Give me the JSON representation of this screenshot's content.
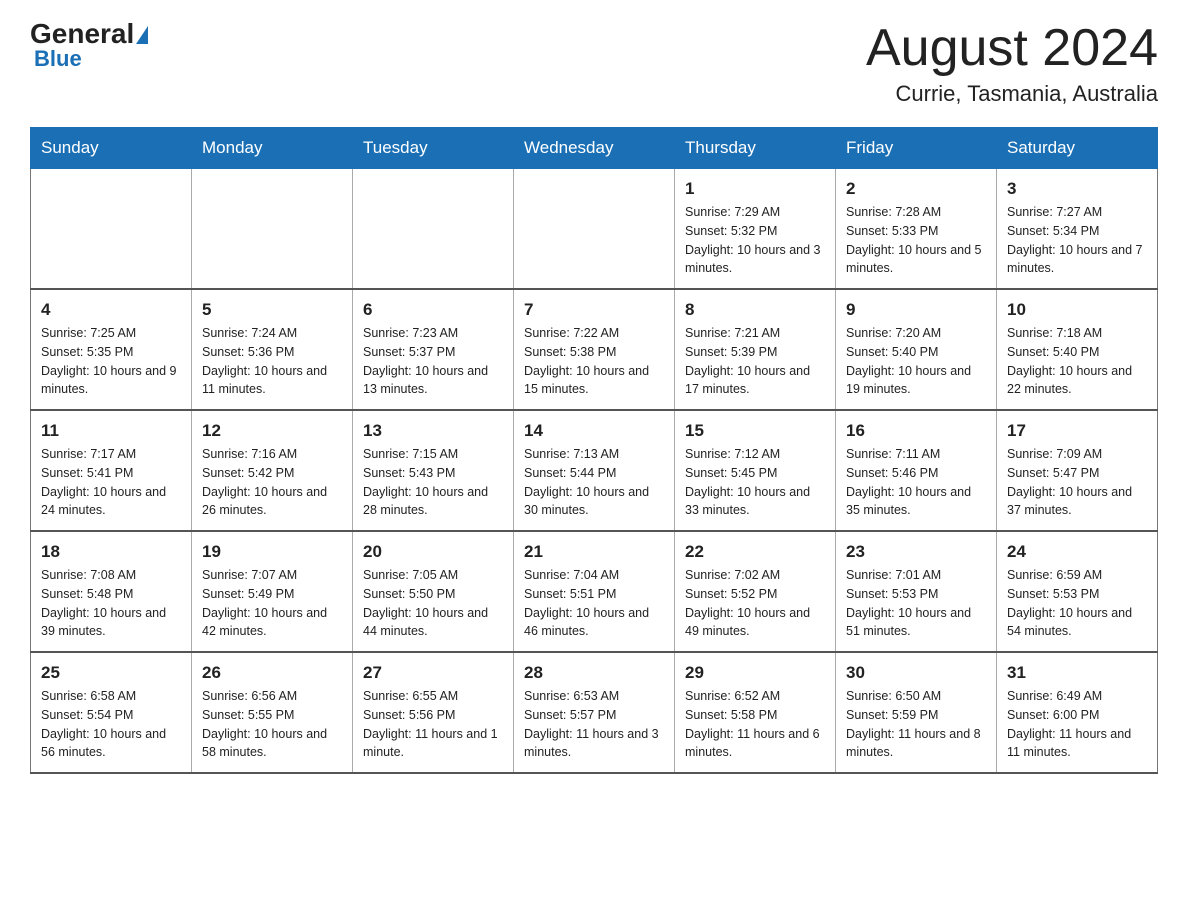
{
  "header": {
    "logo_general": "General",
    "logo_blue": "Blue",
    "title": "August 2024",
    "subtitle": "Currie, Tasmania, Australia"
  },
  "days_of_week": [
    "Sunday",
    "Monday",
    "Tuesday",
    "Wednesday",
    "Thursday",
    "Friday",
    "Saturday"
  ],
  "weeks": [
    [
      {
        "date": "",
        "sunrise": "",
        "sunset": "",
        "daylight": ""
      },
      {
        "date": "",
        "sunrise": "",
        "sunset": "",
        "daylight": ""
      },
      {
        "date": "",
        "sunrise": "",
        "sunset": "",
        "daylight": ""
      },
      {
        "date": "",
        "sunrise": "",
        "sunset": "",
        "daylight": ""
      },
      {
        "date": "1",
        "sunrise": "Sunrise: 7:29 AM",
        "sunset": "Sunset: 5:32 PM",
        "daylight": "Daylight: 10 hours and 3 minutes."
      },
      {
        "date": "2",
        "sunrise": "Sunrise: 7:28 AM",
        "sunset": "Sunset: 5:33 PM",
        "daylight": "Daylight: 10 hours and 5 minutes."
      },
      {
        "date": "3",
        "sunrise": "Sunrise: 7:27 AM",
        "sunset": "Sunset: 5:34 PM",
        "daylight": "Daylight: 10 hours and 7 minutes."
      }
    ],
    [
      {
        "date": "4",
        "sunrise": "Sunrise: 7:25 AM",
        "sunset": "Sunset: 5:35 PM",
        "daylight": "Daylight: 10 hours and 9 minutes."
      },
      {
        "date": "5",
        "sunrise": "Sunrise: 7:24 AM",
        "sunset": "Sunset: 5:36 PM",
        "daylight": "Daylight: 10 hours and 11 minutes."
      },
      {
        "date": "6",
        "sunrise": "Sunrise: 7:23 AM",
        "sunset": "Sunset: 5:37 PM",
        "daylight": "Daylight: 10 hours and 13 minutes."
      },
      {
        "date": "7",
        "sunrise": "Sunrise: 7:22 AM",
        "sunset": "Sunset: 5:38 PM",
        "daylight": "Daylight: 10 hours and 15 minutes."
      },
      {
        "date": "8",
        "sunrise": "Sunrise: 7:21 AM",
        "sunset": "Sunset: 5:39 PM",
        "daylight": "Daylight: 10 hours and 17 minutes."
      },
      {
        "date": "9",
        "sunrise": "Sunrise: 7:20 AM",
        "sunset": "Sunset: 5:40 PM",
        "daylight": "Daylight: 10 hours and 19 minutes."
      },
      {
        "date": "10",
        "sunrise": "Sunrise: 7:18 AM",
        "sunset": "Sunset: 5:40 PM",
        "daylight": "Daylight: 10 hours and 22 minutes."
      }
    ],
    [
      {
        "date": "11",
        "sunrise": "Sunrise: 7:17 AM",
        "sunset": "Sunset: 5:41 PM",
        "daylight": "Daylight: 10 hours and 24 minutes."
      },
      {
        "date": "12",
        "sunrise": "Sunrise: 7:16 AM",
        "sunset": "Sunset: 5:42 PM",
        "daylight": "Daylight: 10 hours and 26 minutes."
      },
      {
        "date": "13",
        "sunrise": "Sunrise: 7:15 AM",
        "sunset": "Sunset: 5:43 PM",
        "daylight": "Daylight: 10 hours and 28 minutes."
      },
      {
        "date": "14",
        "sunrise": "Sunrise: 7:13 AM",
        "sunset": "Sunset: 5:44 PM",
        "daylight": "Daylight: 10 hours and 30 minutes."
      },
      {
        "date": "15",
        "sunrise": "Sunrise: 7:12 AM",
        "sunset": "Sunset: 5:45 PM",
        "daylight": "Daylight: 10 hours and 33 minutes."
      },
      {
        "date": "16",
        "sunrise": "Sunrise: 7:11 AM",
        "sunset": "Sunset: 5:46 PM",
        "daylight": "Daylight: 10 hours and 35 minutes."
      },
      {
        "date": "17",
        "sunrise": "Sunrise: 7:09 AM",
        "sunset": "Sunset: 5:47 PM",
        "daylight": "Daylight: 10 hours and 37 minutes."
      }
    ],
    [
      {
        "date": "18",
        "sunrise": "Sunrise: 7:08 AM",
        "sunset": "Sunset: 5:48 PM",
        "daylight": "Daylight: 10 hours and 39 minutes."
      },
      {
        "date": "19",
        "sunrise": "Sunrise: 7:07 AM",
        "sunset": "Sunset: 5:49 PM",
        "daylight": "Daylight: 10 hours and 42 minutes."
      },
      {
        "date": "20",
        "sunrise": "Sunrise: 7:05 AM",
        "sunset": "Sunset: 5:50 PM",
        "daylight": "Daylight: 10 hours and 44 minutes."
      },
      {
        "date": "21",
        "sunrise": "Sunrise: 7:04 AM",
        "sunset": "Sunset: 5:51 PM",
        "daylight": "Daylight: 10 hours and 46 minutes."
      },
      {
        "date": "22",
        "sunrise": "Sunrise: 7:02 AM",
        "sunset": "Sunset: 5:52 PM",
        "daylight": "Daylight: 10 hours and 49 minutes."
      },
      {
        "date": "23",
        "sunrise": "Sunrise: 7:01 AM",
        "sunset": "Sunset: 5:53 PM",
        "daylight": "Daylight: 10 hours and 51 minutes."
      },
      {
        "date": "24",
        "sunrise": "Sunrise: 6:59 AM",
        "sunset": "Sunset: 5:53 PM",
        "daylight": "Daylight: 10 hours and 54 minutes."
      }
    ],
    [
      {
        "date": "25",
        "sunrise": "Sunrise: 6:58 AM",
        "sunset": "Sunset: 5:54 PM",
        "daylight": "Daylight: 10 hours and 56 minutes."
      },
      {
        "date": "26",
        "sunrise": "Sunrise: 6:56 AM",
        "sunset": "Sunset: 5:55 PM",
        "daylight": "Daylight: 10 hours and 58 minutes."
      },
      {
        "date": "27",
        "sunrise": "Sunrise: 6:55 AM",
        "sunset": "Sunset: 5:56 PM",
        "daylight": "Daylight: 11 hours and 1 minute."
      },
      {
        "date": "28",
        "sunrise": "Sunrise: 6:53 AM",
        "sunset": "Sunset: 5:57 PM",
        "daylight": "Daylight: 11 hours and 3 minutes."
      },
      {
        "date": "29",
        "sunrise": "Sunrise: 6:52 AM",
        "sunset": "Sunset: 5:58 PM",
        "daylight": "Daylight: 11 hours and 6 minutes."
      },
      {
        "date": "30",
        "sunrise": "Sunrise: 6:50 AM",
        "sunset": "Sunset: 5:59 PM",
        "daylight": "Daylight: 11 hours and 8 minutes."
      },
      {
        "date": "31",
        "sunrise": "Sunrise: 6:49 AM",
        "sunset": "Sunset: 6:00 PM",
        "daylight": "Daylight: 11 hours and 11 minutes."
      }
    ]
  ]
}
